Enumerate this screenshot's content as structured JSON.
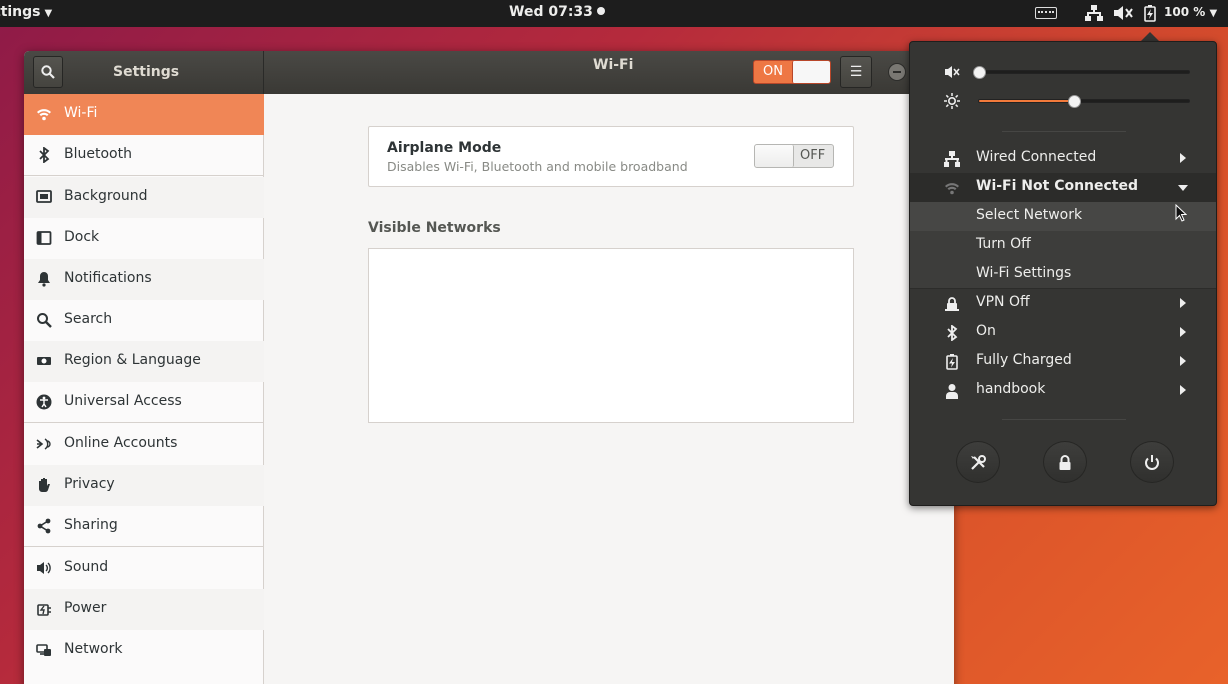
{
  "topbar": {
    "app_menu": "ttings",
    "clock": "Wed 07:33",
    "battery_percent": "100 %",
    "icons": [
      "keyboard-icon",
      "network-icon",
      "volume-muted-icon",
      "battery-charging-icon"
    ]
  },
  "window": {
    "sidebar_title": "Settings",
    "page_title": "Wi-Fi",
    "wifi_switch_label": "ON",
    "wifi_enabled": true
  },
  "sidebar": {
    "items": [
      {
        "label": "Wi-Fi",
        "icon": "wifi-icon",
        "active": true
      },
      {
        "label": "Bluetooth",
        "icon": "bluetooth-icon"
      },
      {
        "label": "Background",
        "icon": "background-icon"
      },
      {
        "label": "Dock",
        "icon": "dock-icon"
      },
      {
        "label": "Notifications",
        "icon": "bell-icon"
      },
      {
        "label": "Search",
        "icon": "search-icon"
      },
      {
        "label": "Region & Language",
        "icon": "region-icon"
      },
      {
        "label": "Universal Access",
        "icon": "universal-access-icon"
      },
      {
        "label": "Online Accounts",
        "icon": "online-accounts-icon"
      },
      {
        "label": "Privacy",
        "icon": "hand-icon"
      },
      {
        "label": "Sharing",
        "icon": "share-icon"
      },
      {
        "label": "Sound",
        "icon": "speaker-icon"
      },
      {
        "label": "Power",
        "icon": "power-plug-icon"
      },
      {
        "label": "Network",
        "icon": "network-icon"
      }
    ]
  },
  "content": {
    "airplane_title": "Airplane Mode",
    "airplane_subtitle": "Disables Wi-Fi, Bluetooth and mobile broadband",
    "airplane_switch_label": "OFF",
    "airplane_enabled": false,
    "visible_networks_title": "Visible Networks"
  },
  "system_menu": {
    "volume_level": 0.0,
    "brightness_level": 0.45,
    "items": [
      {
        "label": "Wired Connected",
        "icon": "wired-network-icon"
      },
      {
        "label": "Wi-Fi Not Connected",
        "icon": "wifi-icon",
        "expanded": true
      },
      {
        "label": "Select Network"
      },
      {
        "label": "Turn Off"
      },
      {
        "label": "Wi-Fi Settings"
      },
      {
        "label": "VPN Off",
        "icon": "vpn-lock-icon"
      },
      {
        "label": "On",
        "icon": "bluetooth-icon"
      },
      {
        "label": "Fully Charged",
        "icon": "battery-charging-icon"
      },
      {
        "label": "handbook",
        "icon": "user-icon"
      }
    ],
    "buttons": [
      "settings-tools-icon",
      "lock-icon",
      "power-icon"
    ]
  },
  "colors": {
    "accent": "#f08656",
    "popover_bg": "#353533",
    "headerbar": "#403f3b"
  }
}
